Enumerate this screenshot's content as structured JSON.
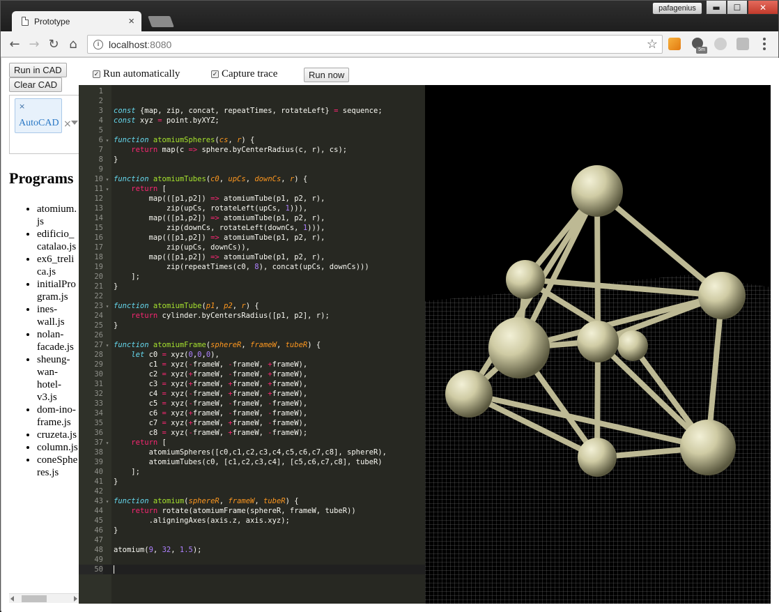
{
  "browser": {
    "tab_title": "Prototype",
    "profile_name": "pafagenius",
    "url_host": "localhost",
    "url_port": ":8080",
    "extension_badge": "5m",
    "window_controls": {
      "minimize": "▬",
      "maximize": "☐",
      "close": "✕"
    }
  },
  "toolbar": {
    "run_in_cad": "Run in CAD",
    "clear_cad": "Clear CAD",
    "run_automatically": "Run automatically",
    "capture_trace": "Capture trace",
    "run_now": "Run now",
    "run_automatically_checked": true,
    "capture_trace_checked": true
  },
  "cad_select": {
    "selected": "AutoCAD"
  },
  "programs": {
    "title": "Programs",
    "items": [
      "atomium.js",
      "edificio_catalao.js",
      "ex6_trelica.js",
      "initialProgram.js",
      "ines-wall.js",
      "nolan-facade.js",
      "sheung-wan-hotel-v3.js",
      "dom-ino-frame.js",
      "cruzeta.js",
      "column.js",
      "coneSpheres.js"
    ]
  },
  "editor": {
    "active_line": 50,
    "lines": [
      {
        "n": 1,
        "fold": false,
        "code": ""
      },
      {
        "n": 2,
        "fold": false,
        "code": ""
      },
      {
        "n": 3,
        "fold": false,
        "code": "<span class=\"k\">const</span> {map, zip, concat, repeatTimes, rotateLeft} <span class=\"r\">=</span> sequence;"
      },
      {
        "n": 4,
        "fold": false,
        "code": "<span class=\"k\">const</span> xyz <span class=\"r\">=</span> point.byXYZ;"
      },
      {
        "n": 5,
        "fold": false,
        "code": ""
      },
      {
        "n": 6,
        "fold": true,
        "code": "<span class=\"k\">function</span> <span class=\"f\">atomiumSpheres</span>(<span class=\"p\">cs</span>, <span class=\"p\">r</span>) {"
      },
      {
        "n": 7,
        "fold": false,
        "code": "    <span class=\"r\">return</span> map(c <span class=\"r\">=&gt;</span> sphere.byCenterRadius(c, r), cs);"
      },
      {
        "n": 8,
        "fold": false,
        "code": "}"
      },
      {
        "n": 9,
        "fold": false,
        "code": ""
      },
      {
        "n": 10,
        "fold": true,
        "code": "<span class=\"k\">function</span> <span class=\"f\">atomiumTubes</span>(<span class=\"p\">c0</span>, <span class=\"p\">upCs</span>, <span class=\"p\">downCs</span>, <span class=\"p\">r</span>) {"
      },
      {
        "n": 11,
        "fold": true,
        "code": "    <span class=\"r\">return</span> ["
      },
      {
        "n": 12,
        "fold": false,
        "code": "        map(([p1,p2]) <span class=\"r\">=&gt;</span> atomiumTube(p1, p2, r),"
      },
      {
        "n": 13,
        "fold": false,
        "code": "            zip(upCs, rotateLeft(upCs, <span class=\"n\">1</span>))),"
      },
      {
        "n": 14,
        "fold": false,
        "code": "        map(([p1,p2]) <span class=\"r\">=&gt;</span> atomiumTube(p1, p2, r),"
      },
      {
        "n": 15,
        "fold": false,
        "code": "            zip(downCs, rotateLeft(downCs, <span class=\"n\">1</span>))),"
      },
      {
        "n": 16,
        "fold": false,
        "code": "        map(([p1,p2]) <span class=\"r\">=&gt;</span> atomiumTube(p1, p2, r),"
      },
      {
        "n": 17,
        "fold": false,
        "code": "            zip(upCs, downCs)),"
      },
      {
        "n": 18,
        "fold": false,
        "code": "        map(([p1,p2]) <span class=\"r\">=&gt;</span> atomiumTube(p1, p2, r),"
      },
      {
        "n": 19,
        "fold": false,
        "code": "            zip(repeatTimes(c0, <span class=\"n\">8</span>), concat(upCs, downCs)))"
      },
      {
        "n": 20,
        "fold": false,
        "code": "    ];"
      },
      {
        "n": 21,
        "fold": false,
        "code": "}"
      },
      {
        "n": 22,
        "fold": false,
        "code": ""
      },
      {
        "n": 23,
        "fold": true,
        "code": "<span class=\"k\">function</span> <span class=\"f\">atomiumTube</span>(<span class=\"p\">p1</span>, <span class=\"p\">p2</span>, <span class=\"p\">r</span>) {"
      },
      {
        "n": 24,
        "fold": false,
        "code": "    <span class=\"r\">return</span> cylinder.byCentersRadius([p1, p2], r);"
      },
      {
        "n": 25,
        "fold": false,
        "code": "}"
      },
      {
        "n": 26,
        "fold": false,
        "code": ""
      },
      {
        "n": 27,
        "fold": true,
        "code": "<span class=\"k\">function</span> <span class=\"f\">atomiumFrame</span>(<span class=\"p\">sphereR</span>, <span class=\"p\">frameW</span>, <span class=\"p\">tubeR</span>) {"
      },
      {
        "n": 28,
        "fold": false,
        "code": "    <span class=\"k\">let</span> c0 <span class=\"r\">=</span> xyz(<span class=\"n\">0</span>,<span class=\"n\">0</span>,<span class=\"n\">0</span>),"
      },
      {
        "n": 29,
        "fold": false,
        "code": "        c1 <span class=\"r\">=</span> xyz(<span class=\"r\">-</span>frameW, <span class=\"r\">-</span>frameW, <span class=\"r\">+</span>frameW),"
      },
      {
        "n": 30,
        "fold": false,
        "code": "        c2 <span class=\"r\">=</span> xyz(<span class=\"r\">+</span>frameW, <span class=\"r\">-</span>frameW, <span class=\"r\">+</span>frameW),"
      },
      {
        "n": 31,
        "fold": false,
        "code": "        c3 <span class=\"r\">=</span> xyz(<span class=\"r\">+</span>frameW, <span class=\"r\">+</span>frameW, <span class=\"r\">+</span>frameW),"
      },
      {
        "n": 32,
        "fold": false,
        "code": "        c4 <span class=\"r\">=</span> xyz(<span class=\"r\">-</span>frameW, <span class=\"r\">+</span>frameW, <span class=\"r\">+</span>frameW),"
      },
      {
        "n": 33,
        "fold": false,
        "code": "        c5 <span class=\"r\">=</span> xyz(<span class=\"r\">-</span>frameW, <span class=\"r\">-</span>frameW, <span class=\"r\">-</span>frameW),"
      },
      {
        "n": 34,
        "fold": false,
        "code": "        c6 <span class=\"r\">=</span> xyz(<span class=\"r\">+</span>frameW, <span class=\"r\">-</span>frameW, <span class=\"r\">-</span>frameW),"
      },
      {
        "n": 35,
        "fold": false,
        "code": "        c7 <span class=\"r\">=</span> xyz(<span class=\"r\">+</span>frameW, <span class=\"r\">+</span>frameW, <span class=\"r\">-</span>frameW),"
      },
      {
        "n": 36,
        "fold": false,
        "code": "        c8 <span class=\"r\">=</span> xyz(<span class=\"r\">-</span>frameW, <span class=\"r\">+</span>frameW, <span class=\"r\">-</span>frameW);"
      },
      {
        "n": 37,
        "fold": true,
        "code": "    <span class=\"r\">return</span> ["
      },
      {
        "n": 38,
        "fold": false,
        "code": "        atomiumSpheres([c0,c1,c2,c3,c4,c5,c6,c7,c8], sphereR),"
      },
      {
        "n": 39,
        "fold": false,
        "code": "        atomiumTubes(c0, [c1,c2,c3,c4], [c5,c6,c7,c8], tubeR)"
      },
      {
        "n": 40,
        "fold": false,
        "code": "    ];"
      },
      {
        "n": 41,
        "fold": false,
        "code": "}"
      },
      {
        "n": 42,
        "fold": false,
        "code": ""
      },
      {
        "n": 43,
        "fold": true,
        "code": "<span class=\"k\">function</span> <span class=\"f\">atomium</span>(<span class=\"p\">sphereR</span>, <span class=\"p\">frameW</span>, <span class=\"p\">tubeR</span>) {"
      },
      {
        "n": 44,
        "fold": false,
        "code": "    <span class=\"r\">return</span> rotate(atomiumFrame(sphereR, frameW, tubeR))"
      },
      {
        "n": 45,
        "fold": false,
        "code": "        .aligningAxes(axis.z, axis.xyz);"
      },
      {
        "n": 46,
        "fold": false,
        "code": "}"
      },
      {
        "n": 47,
        "fold": false,
        "code": ""
      },
      {
        "n": 48,
        "fold": false,
        "code": "atomium(<span class=\"n\">9</span>, <span class=\"n\">32</span>, <span class=\"n\">1.5</span>);"
      },
      {
        "n": 49,
        "fold": false,
        "code": ""
      },
      {
        "n": 50,
        "fold": false,
        "code": ""
      }
    ]
  },
  "viewport": {
    "background": "#000000",
    "model_color": "#d9d6b4",
    "grid_color": "#8a8a8a"
  }
}
